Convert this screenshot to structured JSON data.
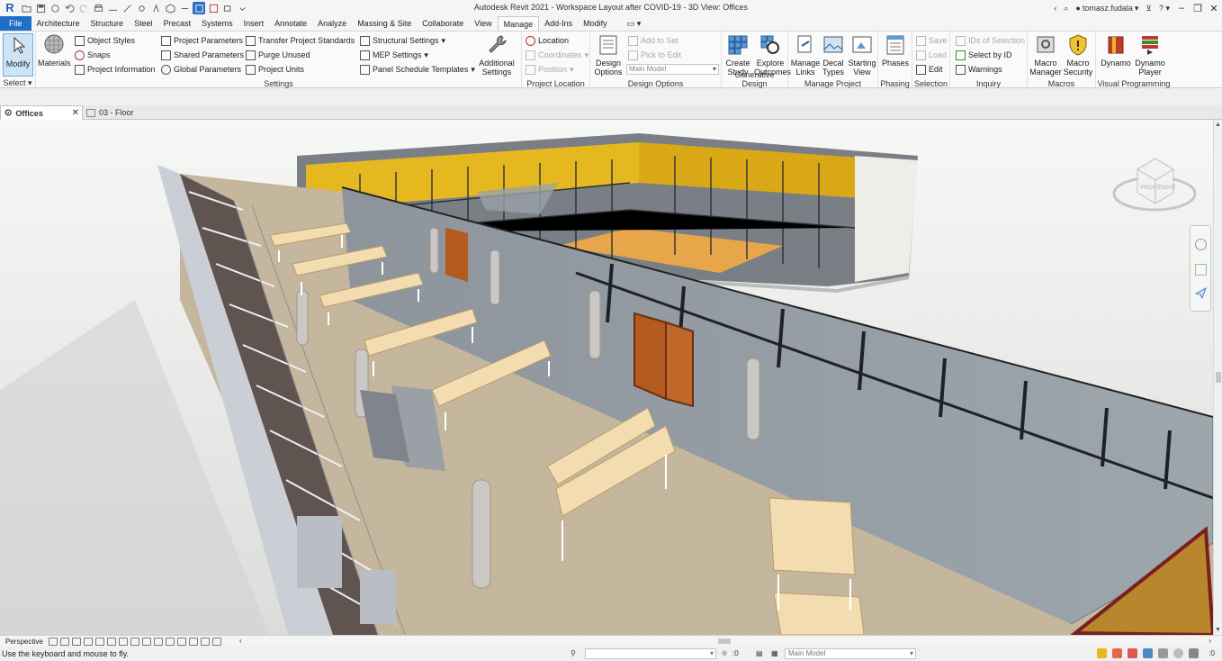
{
  "window": {
    "title": "Autodesk Revit 2021 - Workspace Layout after COVID-19 - 3D View: Offices",
    "user": "tomasz.fudala",
    "help_icon": "question-icon"
  },
  "tabs": [
    "File",
    "Architecture",
    "Structure",
    "Steel",
    "Precast",
    "Systems",
    "Insert",
    "Annotate",
    "Analyze",
    "Massing & Site",
    "Collaborate",
    "View",
    "Manage",
    "Add-Ins",
    "Modify"
  ],
  "active_tab": "Manage",
  "ribbon": {
    "select": {
      "modify": "Modify",
      "panel": "Select"
    },
    "settings": {
      "materials": "Materials",
      "object_styles": "Object Styles",
      "snaps": "Snaps",
      "project_information": "Project Information",
      "project_parameters": "Project Parameters",
      "shared_parameters": "Shared Parameters",
      "global_parameters": "Global Parameters",
      "transfer_project_standards": "Transfer Project Standards",
      "purge_unused": "Purge Unused",
      "project_units": "Project Units",
      "structural_settings": "Structural Settings",
      "mep_settings": "MEP Settings",
      "panel_schedule_templates": "Panel Schedule Templates",
      "additional_settings_1": "Additional",
      "additional_settings_2": "Settings",
      "panel": "Settings"
    },
    "project_location": {
      "location": "Location",
      "coordinates": "Coordinates",
      "position": "Position",
      "panel": "Project Location"
    },
    "design_options": {
      "design_options_1": "Design",
      "design_options_2": "Options",
      "add_to_set": "Add to Set",
      "pick_to_edit": "Pick to Edit",
      "main_model": "Main Model",
      "panel": "Design Options"
    },
    "generative_design": {
      "create_study_1": "Create",
      "create_study_2": "Study",
      "explore_outcomes_1": "Explore",
      "explore_outcomes_2": "Outcomes",
      "panel": "Generative Design"
    },
    "manage_project": {
      "manage_links_1": "Manage",
      "manage_links_2": "Links",
      "decal_types_1": "Decal",
      "decal_types_2": "Types",
      "starting_view_1": "Starting",
      "starting_view_2": "View",
      "panel": "Manage Project"
    },
    "phasing": {
      "phases": "Phases",
      "panel": "Phasing"
    },
    "selection": {
      "save": "Save",
      "load": "Load",
      "edit": "Edit",
      "panel": "Selection"
    },
    "inquiry": {
      "ids_of_selection": "IDs of Selection",
      "select_by_id": "Select by ID",
      "warnings": "Warnings",
      "panel": "Inquiry"
    },
    "macros": {
      "macro_manager_1": "Macro",
      "macro_manager_2": "Manager",
      "macro_security_1": "Macro",
      "macro_security_2": "Security",
      "panel": "Macros"
    },
    "visual_programming": {
      "dynamo": "Dynamo",
      "dynamo_player_1": "Dynamo",
      "dynamo_player_2": "Player",
      "panel": "Visual Programming"
    }
  },
  "view_tabs": [
    {
      "label": "Offices",
      "active": true
    },
    {
      "label": "03 - Floor",
      "active": false
    }
  ],
  "view_control": {
    "mode": "Perspective"
  },
  "status": {
    "message": "Use the keyboard and mouse to fly.",
    "workset_value": ":0",
    "model": "Main Model",
    "filter_count": ":0"
  },
  "colors": {
    "file_tab": "#1f6fc8",
    "accent_yellow": "#e6b820",
    "door": "#b35a1f",
    "floor": "#c8b8a0",
    "desk": "#f3dcb0"
  }
}
